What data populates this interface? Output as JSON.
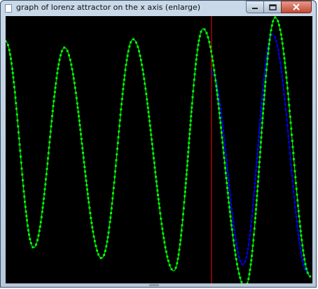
{
  "window": {
    "title": "graph of lorenz attractor on the x axis (enlarge)",
    "controls": [
      {
        "name": "minimize",
        "icon": "minimize-icon"
      },
      {
        "name": "maximize",
        "icon": "maximize-icon"
      },
      {
        "name": "close",
        "icon": "close-icon"
      }
    ]
  },
  "plot": {
    "background": "#000000",
    "marker_color": "#ff0000",
    "series": [
      {
        "color": "#00ff00"
      },
      {
        "color": "#0000ff"
      }
    ]
  }
}
